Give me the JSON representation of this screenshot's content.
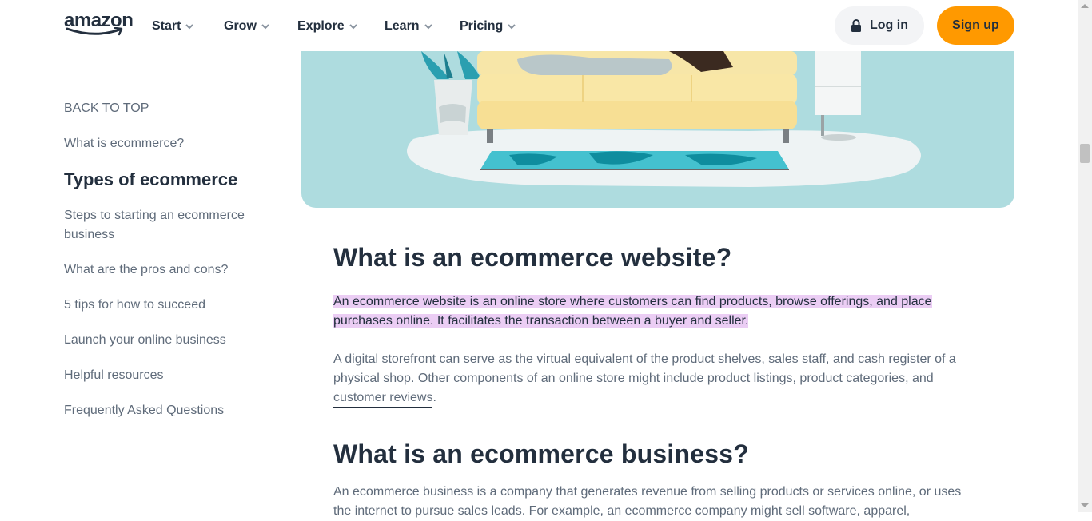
{
  "header": {
    "logo_alt": "amazon",
    "nav": [
      {
        "label": "Start"
      },
      {
        "label": "Grow"
      },
      {
        "label": "Explore"
      },
      {
        "label": "Learn"
      },
      {
        "label": "Pricing"
      }
    ],
    "login_label": "Log in",
    "signup_label": "Sign up"
  },
  "toc": {
    "items": [
      {
        "label": "BACK TO TOP"
      },
      {
        "label": "What is ecommerce?"
      },
      {
        "label": "Types of ecommerce",
        "active": true
      },
      {
        "label": "Steps to starting an ecommerce business"
      },
      {
        "label": "What are the pros and cons?"
      },
      {
        "label": "5 tips for how to succeed"
      },
      {
        "label": "Launch your online business"
      },
      {
        "label": "Helpful resources"
      },
      {
        "label": "Frequently Asked Questions"
      }
    ]
  },
  "article": {
    "section1": {
      "heading": "What is an ecommerce website?",
      "highlighted_paragraph": "An ecommerce website is an online store where customers can find products, browse offerings, and place purchases online. It facilitates the transaction between a buyer and seller.",
      "paragraph2_text": "A digital storefront can serve as the virtual equivalent of the product shelves, sales staff, and cash register of a physical shop. Other components of an online store might include product listings, product categories, and ",
      "paragraph2_link": "customer reviews",
      "paragraph2_end": "."
    },
    "section2": {
      "heading": "What is an ecommerce business?",
      "paragraph": "An ecommerce business is a company that generates revenue from selling products or services online, or uses the internet to pursue sales leads. For example, an ecommerce company might sell software, apparel,"
    }
  },
  "colors": {
    "accent": "#ff9900",
    "text_dark": "#232f3e",
    "text_muted": "#5f6b7a",
    "highlight": "#ebcdf4",
    "hero_bg": "#aedcdf"
  }
}
